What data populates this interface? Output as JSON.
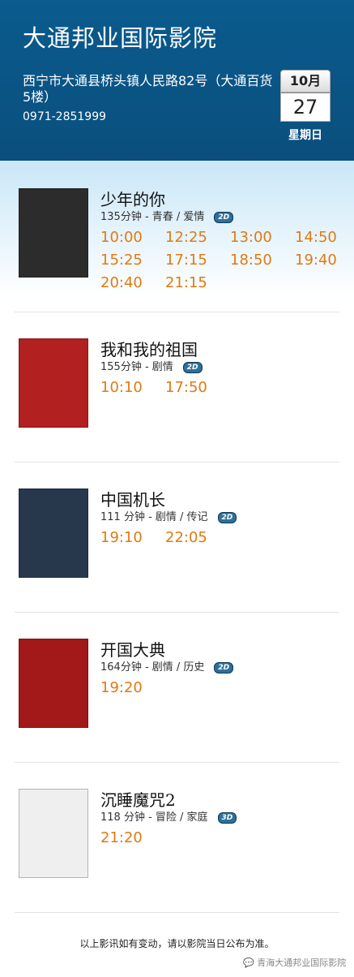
{
  "header": {
    "cinema_name": "大通邦业国际影院",
    "address": "西宁市大通县桥头镇人民路82号（大通百货5楼）",
    "phone": "0971-2851999",
    "calendar": {
      "month": "10月",
      "day": "27",
      "weekday": "星期日"
    }
  },
  "movies": [
    {
      "title": "少年的你",
      "meta": "135分钟 - 青春 / 爱情",
      "format": "2D",
      "times": [
        "10:00",
        "12:25",
        "13:00",
        "14:50",
        "15:25",
        "17:15",
        "18:50",
        "19:40",
        "20:40",
        "21:15"
      ],
      "poster_color": "#2c2c2c"
    },
    {
      "title": "我和我的祖国",
      "meta": "155分钟 - 剧情",
      "format": "2D",
      "times": [
        "10:10",
        "17:50"
      ],
      "poster_color": "#b22020"
    },
    {
      "title": "中国机长",
      "meta": "111 分钟 - 剧情 / 传记",
      "format": "2D",
      "times": [
        "19:10",
        "22:05"
      ],
      "poster_color": "#27384d"
    },
    {
      "title": "开国大典",
      "meta": "164分钟 - 剧情 / 历史",
      "format": "2D",
      "times": [
        "19:20"
      ],
      "poster_color": "#a31818"
    },
    {
      "title": "沉睡魔咒2",
      "meta": "118 分钟 - 冒险 / 家庭",
      "format": "3D",
      "times": [
        "21:20"
      ],
      "poster_color": "#efefef"
    }
  ],
  "footer": {
    "notice": "以上影讯如有变动，请以影院当日公布为准。",
    "watermark": "青海大通邦业国际影院"
  }
}
